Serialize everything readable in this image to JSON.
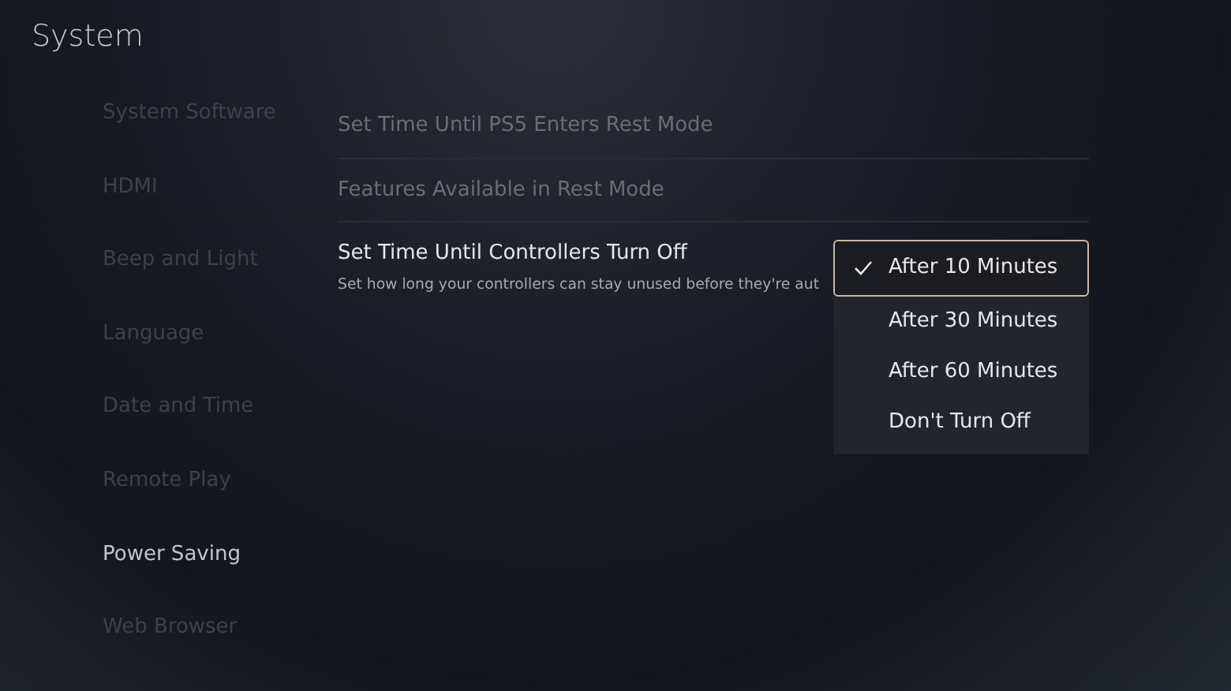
{
  "title": "System",
  "sidebar": {
    "items": [
      {
        "label": "System Software",
        "selected": false
      },
      {
        "label": "HDMI",
        "selected": false
      },
      {
        "label": "Beep and Light",
        "selected": false
      },
      {
        "label": "Language",
        "selected": false
      },
      {
        "label": "Date and Time",
        "selected": false
      },
      {
        "label": "Remote Play",
        "selected": false
      },
      {
        "label": "Power Saving",
        "selected": true
      },
      {
        "label": "Web Browser",
        "selected": false
      }
    ]
  },
  "settings": [
    {
      "label": "Set Time Until PS5 Enters Rest Mode",
      "selected": false
    },
    {
      "label": "Features Available in Rest Mode",
      "selected": false
    },
    {
      "label": "Set Time Until Controllers Turn Off",
      "selected": true,
      "description": "Set how long your controllers can stay unused before they're aut"
    }
  ],
  "dropdown": {
    "options": [
      {
        "label": "After 10 Minutes",
        "selected": true
      },
      {
        "label": "After 30 Minutes",
        "selected": false
      },
      {
        "label": "After 60 Minutes",
        "selected": false
      },
      {
        "label": "Don't Turn Off",
        "selected": false
      }
    ]
  }
}
